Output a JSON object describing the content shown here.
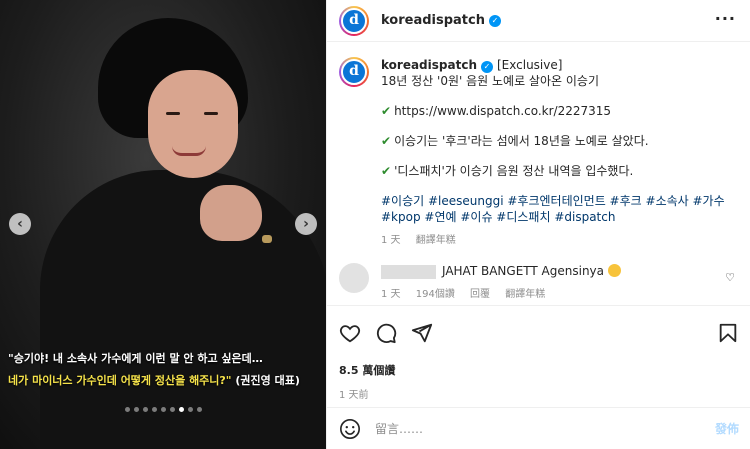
{
  "post": {
    "username": "koreadispatch",
    "avatar_letter": "d",
    "more_label": "···"
  },
  "media": {
    "caption_line1": "\"승기야! 내 소속사 가수에게 이런 말 안 하고 싶은데…",
    "caption_line2_highlight": "네가 마이너스 가수인데 어떻게 정산을 해주니?\"",
    "caption_line2_speaker": " (권진영 대표)",
    "prev_label": "‹",
    "next_label": "›",
    "slide_count": 9,
    "active_slide": 7
  },
  "caption": {
    "username": "koreadispatch",
    "title_line1": "[Exclusive]",
    "title_line2": "18년 정산 '0원' 음원 노예로 살아온 이승기",
    "bullet1": "https://www.dispatch.co.kr/2227315",
    "bullet2": "이승기는 '후크'라는 섬에서 18년을 노예로 살았다.",
    "bullet3": "'디스패치'가 이승기 음원 정산 내역을 입수했다.",
    "hashtags": "#이승기 #leeseunggi #후크엔터테인먼트 #후크 #소속사 #가수 #kpop #연예 #이슈 #디스패치 #dispatch",
    "age": "1 天",
    "translate": "翻譯年糕"
  },
  "comment": {
    "text": "JAHAT BANGETT Agensinya",
    "age": "1 天",
    "likes": "194個讚",
    "reply": "回覆",
    "translate": "翻譯年糕"
  },
  "stats": {
    "views": "8.5 萬個讚",
    "time": "1 天前"
  },
  "composer": {
    "placeholder": "留言……",
    "post_label": "發佈"
  },
  "colors": {
    "accent": "#0095f6",
    "hashtag": "#00376b",
    "caption_highlight": "#f5e24a"
  }
}
